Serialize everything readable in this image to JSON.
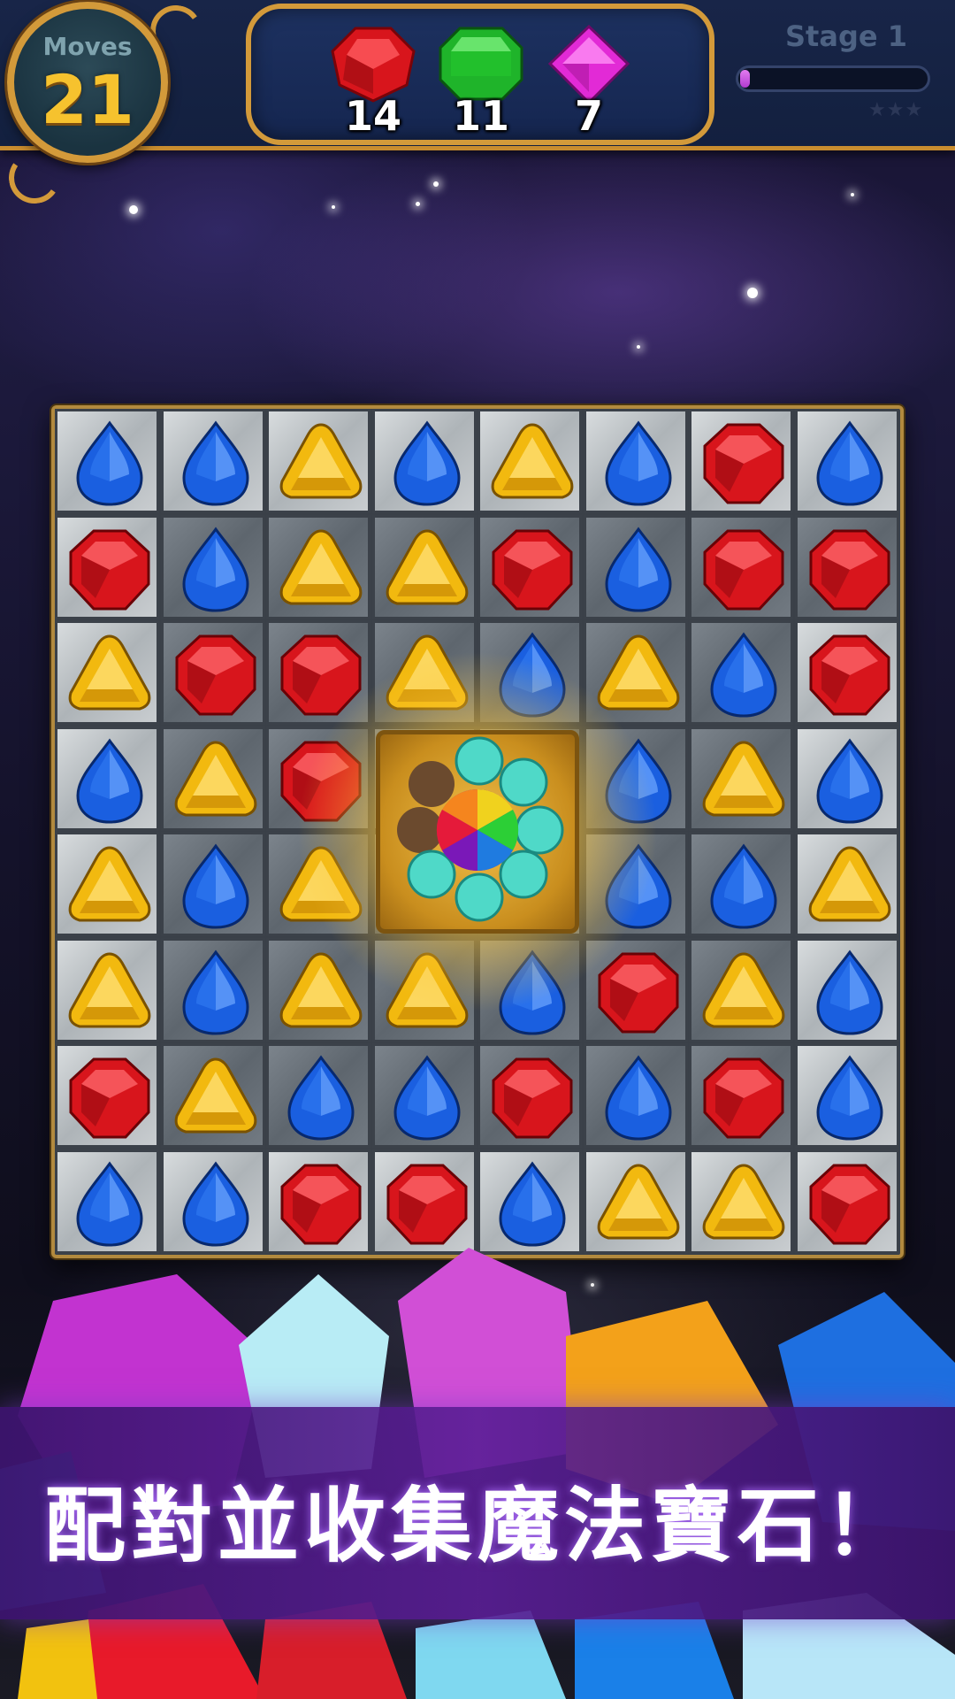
{
  "hud": {
    "moves_label": "Moves",
    "moves_value": "21",
    "goals": [
      {
        "gem": "red-gem-icon",
        "color": "#d8151c",
        "count": "14"
      },
      {
        "gem": "green-gem-icon",
        "color": "#1fb42a",
        "count": "11"
      },
      {
        "gem": "purple-gem-icon",
        "color": "#e22ad6",
        "count": "7"
      }
    ],
    "stage_label": "Stage 1",
    "progress": 0.05,
    "stars_earned": 0,
    "stars_total": 3
  },
  "board": {
    "rows": 8,
    "cols": 8,
    "grid": [
      [
        "B",
        "B",
        "Y",
        "B",
        "Y",
        "B",
        "R",
        "B"
      ],
      [
        "R",
        "B",
        "Y",
        "Y",
        "R",
        "B",
        "R",
        "R"
      ],
      [
        "Y",
        "R",
        "R",
        "Y",
        "B",
        "Y",
        "B",
        "R"
      ],
      [
        "B",
        "Y",
        "R",
        "S",
        "S",
        "B",
        "Y",
        "B"
      ],
      [
        "Y",
        "B",
        "Y",
        "S",
        "S",
        "B",
        "B",
        "Y"
      ],
      [
        "Y",
        "B",
        "Y",
        "Y",
        "B",
        "R",
        "Y",
        "B"
      ],
      [
        "R",
        "Y",
        "B",
        "B",
        "R",
        "B",
        "R",
        "B"
      ],
      [
        "B",
        "B",
        "R",
        "R",
        "B",
        "Y",
        "Y",
        "R"
      ]
    ],
    "gem_colors": {
      "B": "#1a5fe0",
      "R": "#d8151c",
      "Y": "#f2b90f"
    },
    "special_item": "rainbow-gem-cluster-icon"
  },
  "banner": {
    "text": "配對並收集魔法寶石！"
  }
}
